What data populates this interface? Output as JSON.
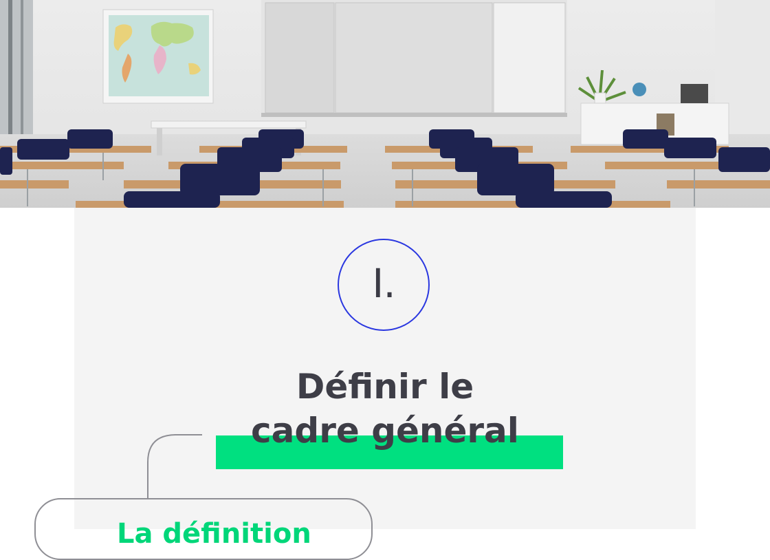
{
  "section": {
    "numeral": "I.",
    "title_line1": "Définir le",
    "title_line2": "cadre général"
  },
  "card": {
    "heading": "La définition"
  },
  "colors": {
    "accent_blue": "#2a37e0",
    "highlight_green": "#00e080",
    "panel_bg": "#f4f4f4",
    "title_text": "#3e3e47"
  },
  "icons": [
    "classroom-photo",
    "circle-numeral-badge",
    "connector-line"
  ]
}
